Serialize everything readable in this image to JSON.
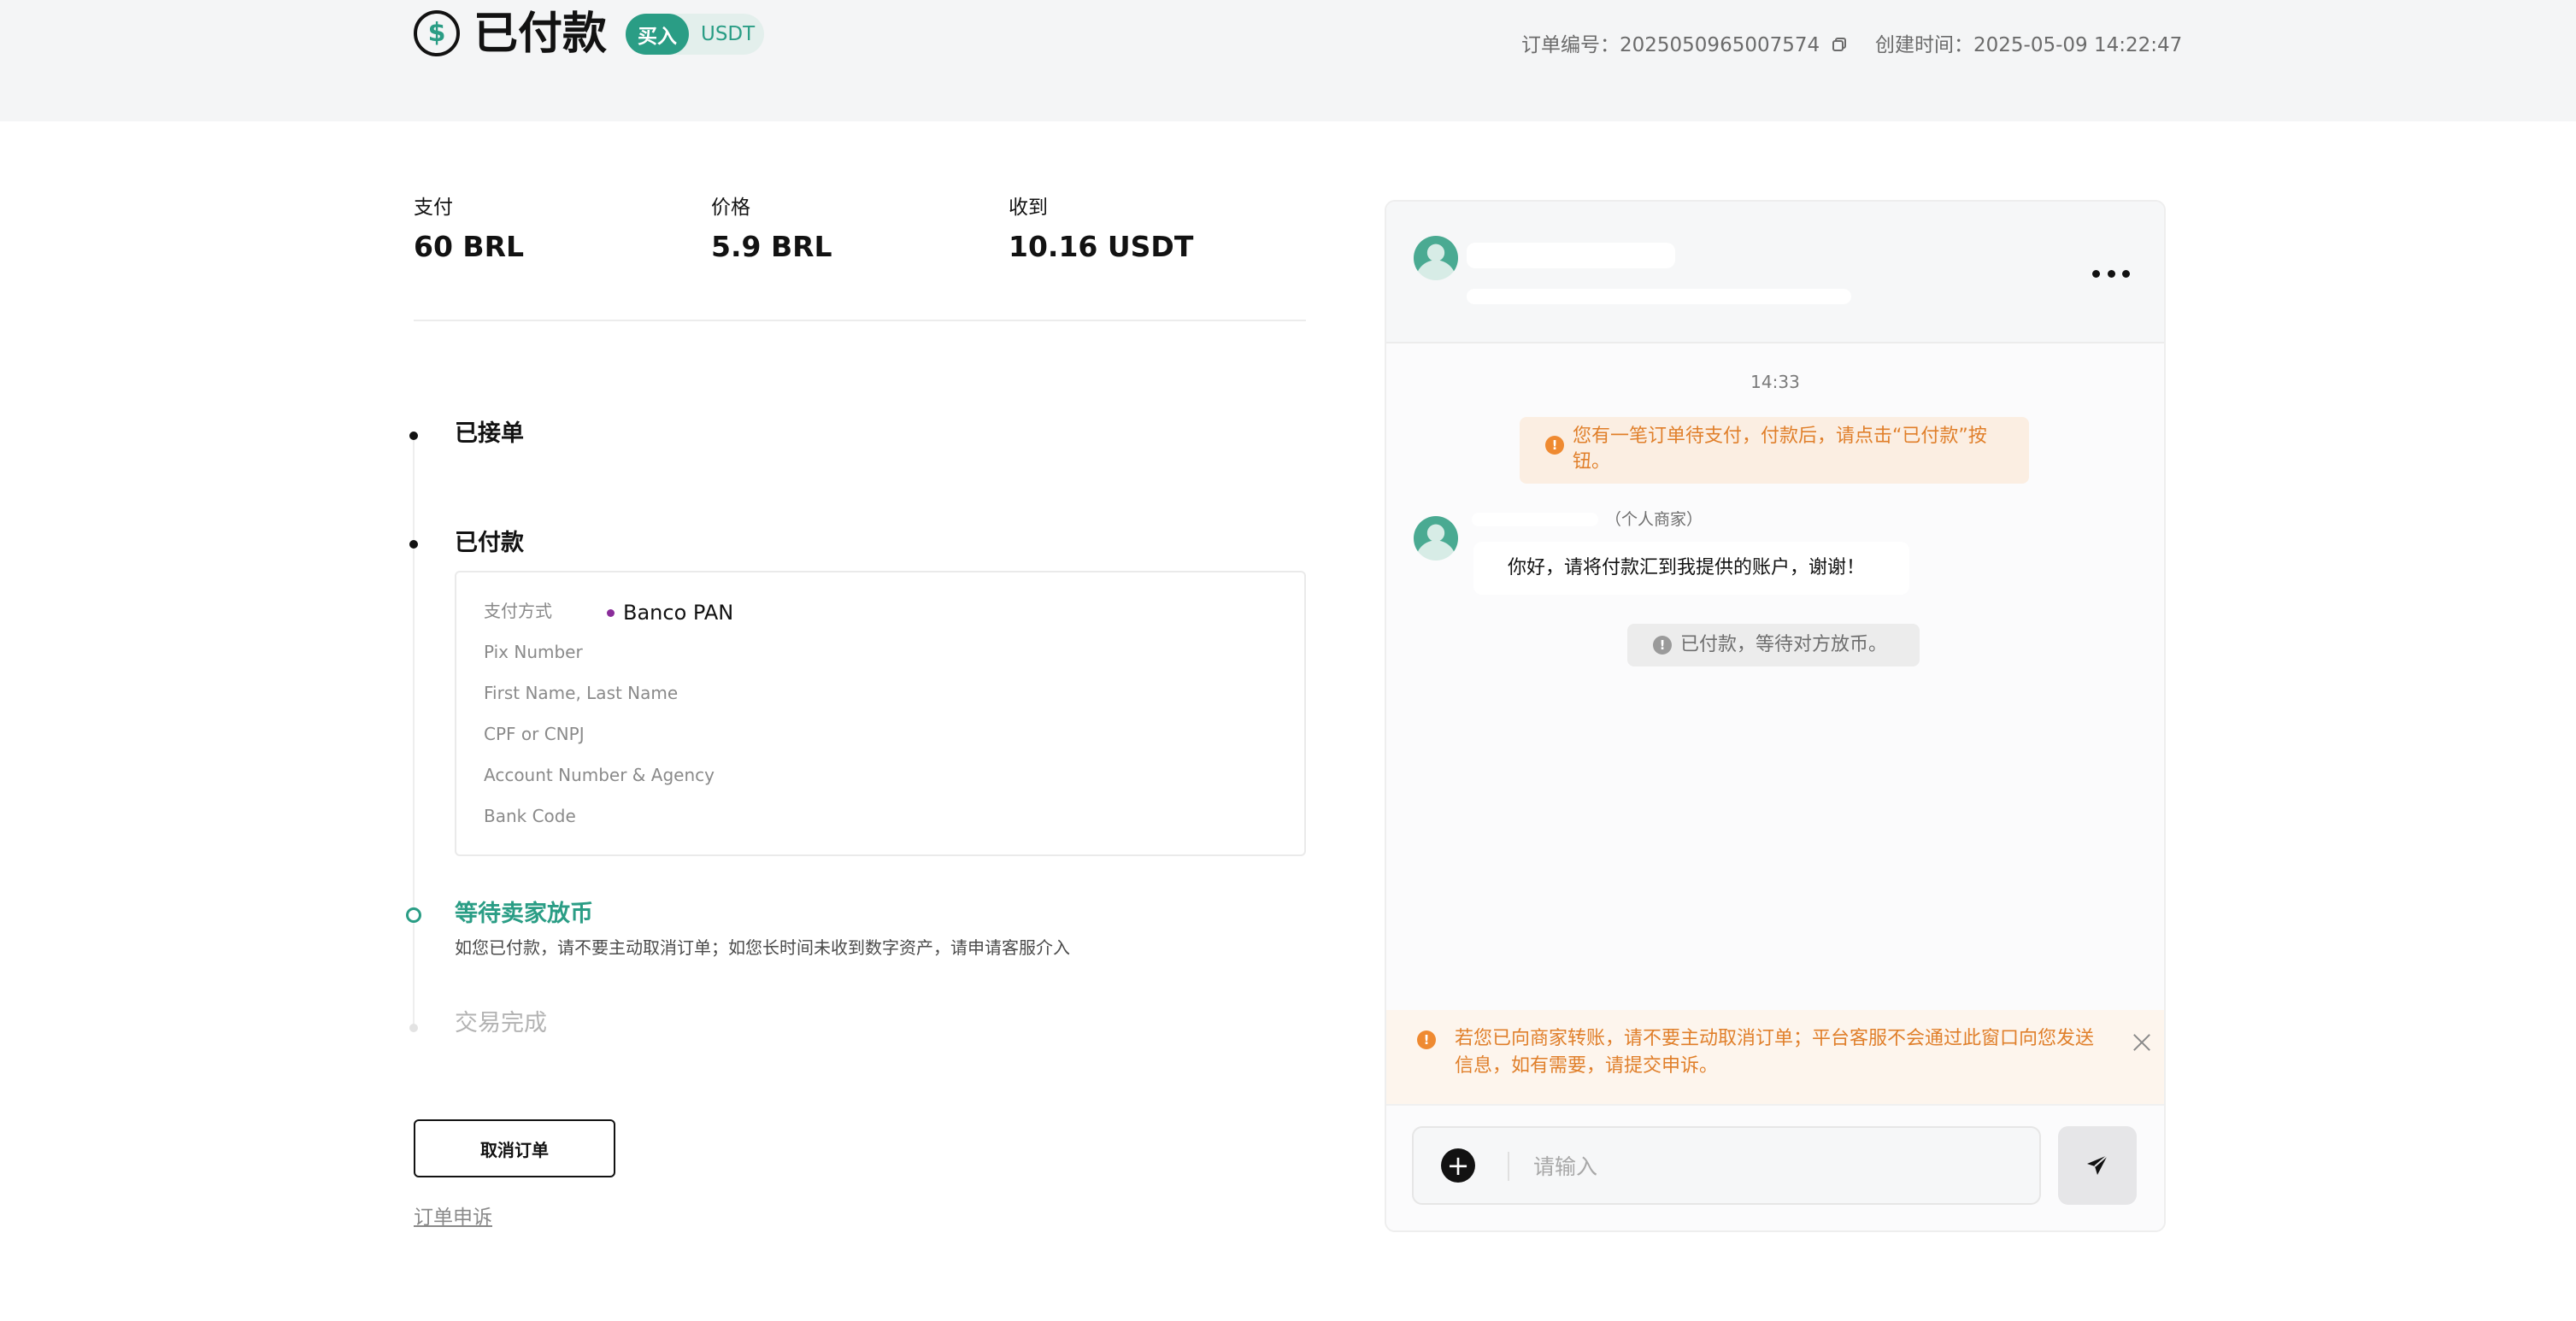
{
  "header": {
    "status_icon": "dollar-circle-icon",
    "status_icon_glyph": "$",
    "status_title": "已付款",
    "side_label": "买入",
    "coin_label": "USDT",
    "order_no_label": "订单编号：",
    "order_no_value": "2025050965007574",
    "created_label": "创建时间：",
    "created_value": "2025-05-09 14:22:47"
  },
  "summary": {
    "pay_label": "支付",
    "pay_value": "60 BRL",
    "price_label": "价格",
    "price_value": "5.9 BRL",
    "receive_label": "收到",
    "receive_value": "10.16 USDT"
  },
  "timeline": {
    "step1": "已接单",
    "step2": "已付款",
    "step3": "等待卖家放币",
    "step3_desc": "如您已付款，请不要主动取消订单；如您长时间未收到数字资产，请申请客服介入",
    "step4": "交易完成"
  },
  "payment": {
    "method_label": "支付方式",
    "method_value": "Banco PAN",
    "fields": [
      "Pix Number",
      "First Name, Last Name",
      "CPF or CNPJ",
      "Account Number & Agency",
      "Bank Code"
    ]
  },
  "actions": {
    "cancel_label": "取消订单",
    "appeal_label": "订单申诉"
  },
  "chat": {
    "time": "14:33",
    "system_warning": "您有一笔订单待支付，付款后，请点击“已付款”按钮。",
    "merchant_tag": "（个人商家）",
    "merchant_message": "你好，请将付款汇到我提供的账户，谢谢！",
    "system_status": "已付款，等待对方放币。",
    "notice": "若您已向商家转账，请不要主动取消订单；平台客服不会通过此窗口向您发送信息，如有需要，请提交申诉。",
    "input_placeholder": "请输入",
    "warn_glyph": "!"
  },
  "colors": {
    "accent": "#2a9d85",
    "warning": "#e07f2a",
    "pay_method_dot": "#8a2d9a"
  }
}
